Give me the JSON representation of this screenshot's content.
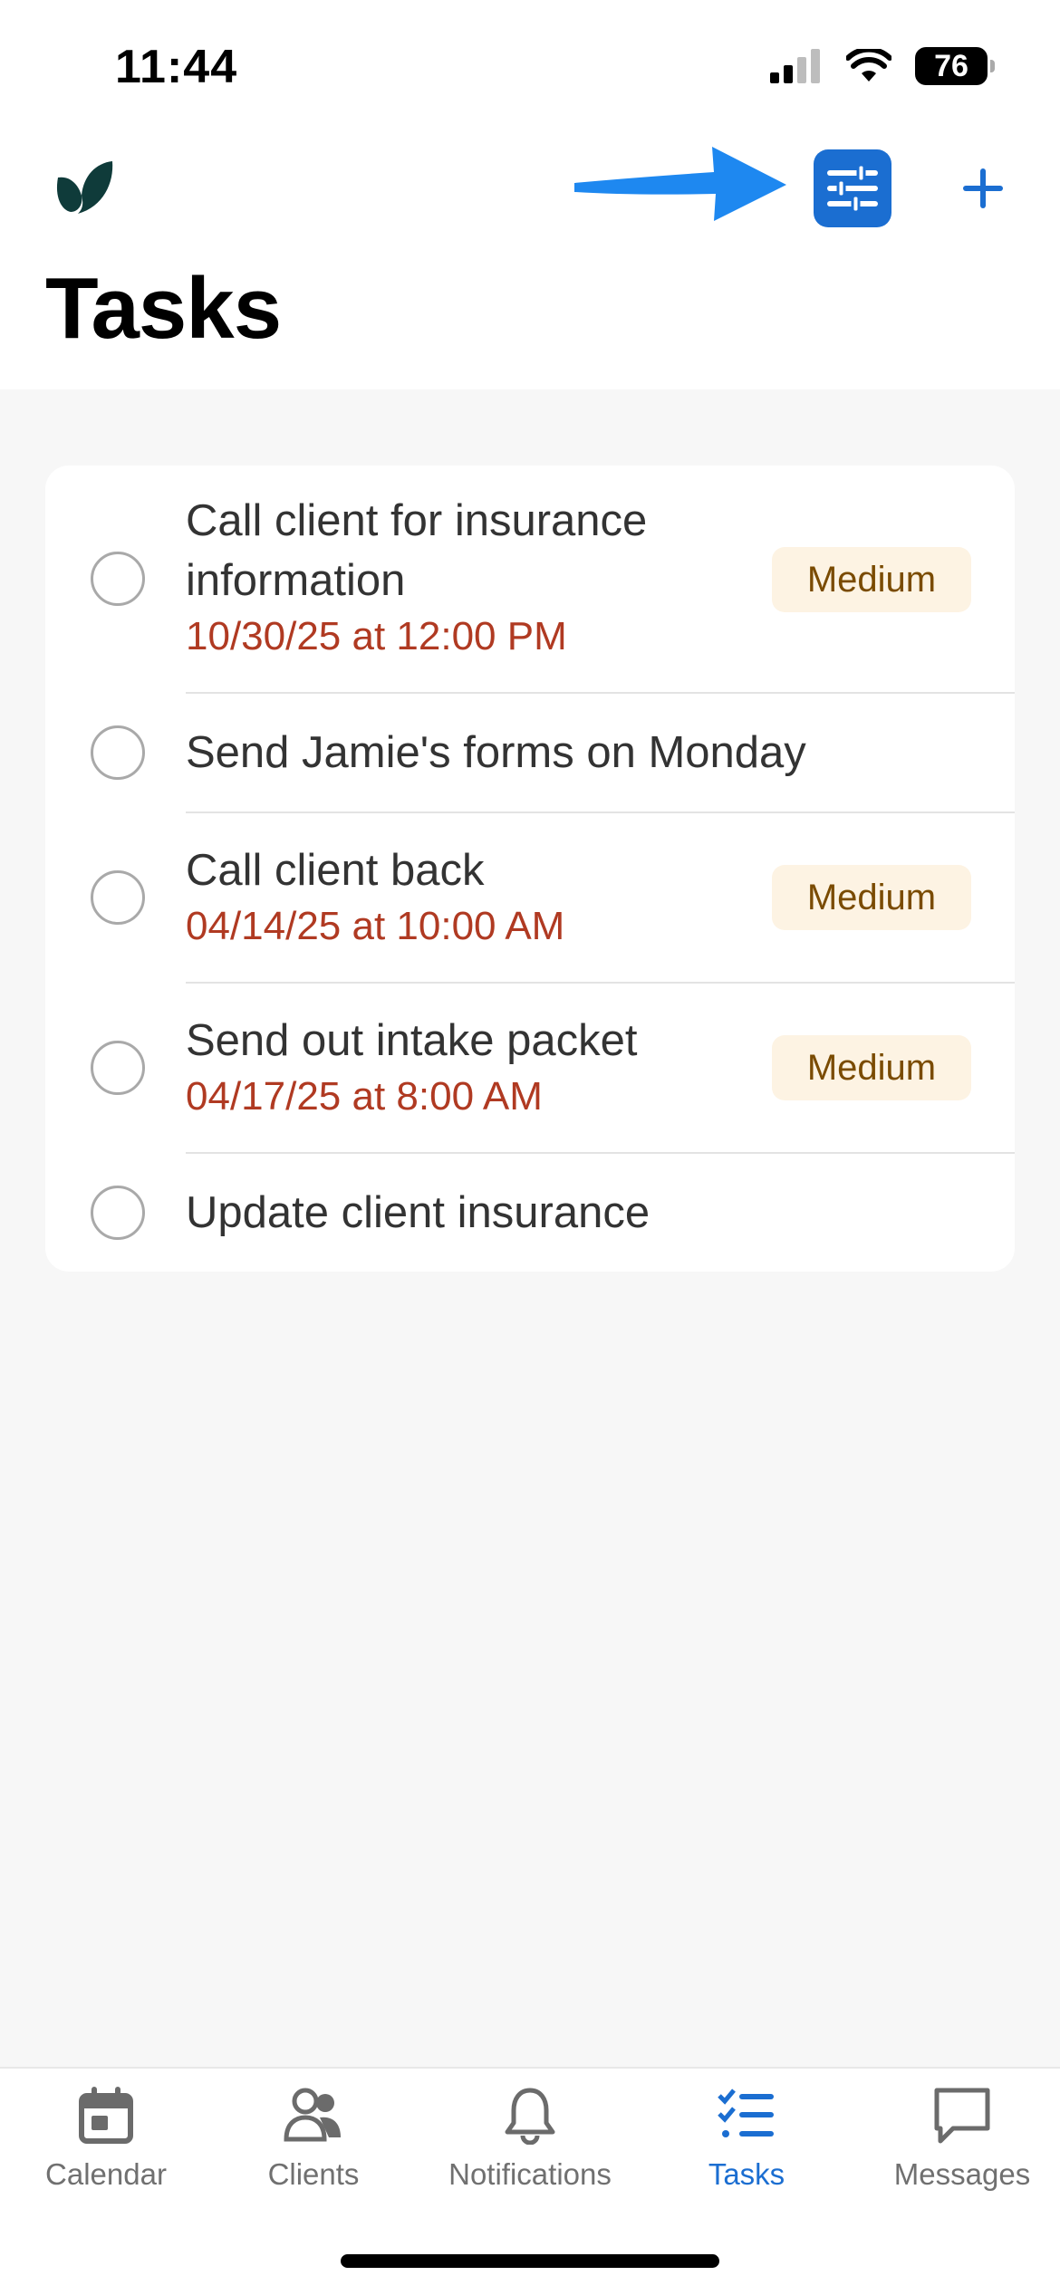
{
  "status_bar": {
    "time": "11:44",
    "battery": "76"
  },
  "header": {
    "title": "Tasks",
    "filter_icon": "sliders-icon",
    "add_icon": "plus-icon"
  },
  "colors": {
    "accent": "#1b6ed1",
    "due": "#b03a22",
    "badge_bg": "#fdf3e3",
    "badge_text": "#7a4b00"
  },
  "tasks": [
    {
      "title_line1": "Call client for insurance",
      "title_line2": "information",
      "due": "10/30/25 at 12:00 PM",
      "priority": "Medium"
    },
    {
      "title": "Send Jamie's forms on Monday"
    },
    {
      "title": "Call client back",
      "due": "04/14/25 at 10:00 AM",
      "priority": "Medium"
    },
    {
      "title": "Send out intake packet",
      "due": "04/17/25 at 8:00 AM",
      "priority": "Medium"
    },
    {
      "title": "Update client insurance"
    }
  ],
  "nav": [
    {
      "label": "Calendar",
      "icon": "calendar-icon"
    },
    {
      "label": "Clients",
      "icon": "people-icon"
    },
    {
      "label": "Notifications",
      "icon": "bell-icon"
    },
    {
      "label": "Tasks",
      "icon": "checklist-icon",
      "active": true
    },
    {
      "label": "Messages",
      "icon": "chat-bubble-icon"
    }
  ]
}
